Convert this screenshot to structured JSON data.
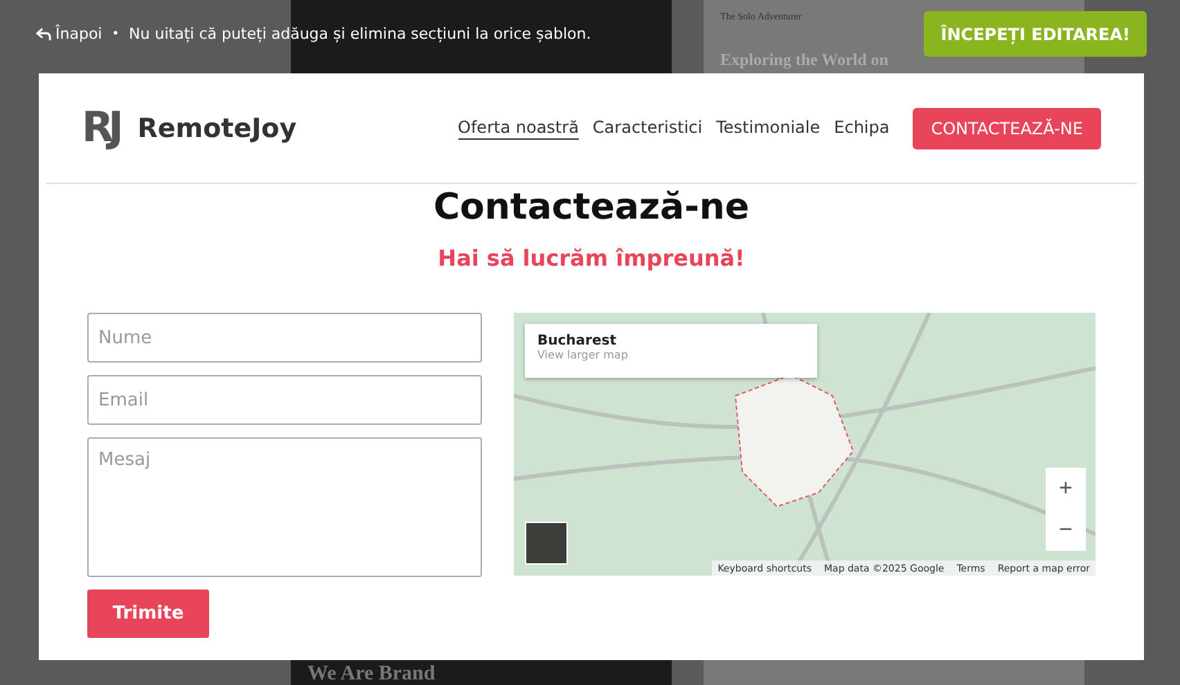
{
  "background_templates": [
    {
      "kind": "light",
      "site_title": "The Solo Adventurer",
      "headline": "Exploring the World on"
    },
    {
      "kind": "dark",
      "headline": "We Are Brand"
    }
  ],
  "top_bar": {
    "back_label": "Înapoi",
    "separator": "•",
    "hint": "Nu uitați că puteți adăuga și elimina secțiuni la orice șablon.",
    "start_button": "ÎNCEPEȚI EDITAREA!"
  },
  "site": {
    "logo_mark": "RJ",
    "brand": "RemoteJoy",
    "nav": [
      {
        "label": "Oferta noastră",
        "selected": true
      },
      {
        "label": "Caracteristici",
        "selected": false
      },
      {
        "label": "Testimoniale",
        "selected": false
      },
      {
        "label": "Echipa",
        "selected": false
      }
    ],
    "nav_button": "CONTACTEAZĂ-NE",
    "title": "Contactează-ne",
    "subtitle": "Hai să lucrăm împreună!",
    "form": {
      "fields": [
        {
          "kind": "line",
          "placeholder": "Nume"
        },
        {
          "kind": "line",
          "placeholder": "Email"
        },
        {
          "kind": "area",
          "placeholder": "Mesaj"
        }
      ],
      "submit": "Trimite"
    },
    "map": {
      "place": "Bucharest",
      "link": "View larger map",
      "zoom_in": "+",
      "zoom_out": "−",
      "attribution": [
        "Keyboard shortcuts",
        "Map data ©2025 Google",
        "Terms",
        "Report a map error"
      ]
    }
  }
}
